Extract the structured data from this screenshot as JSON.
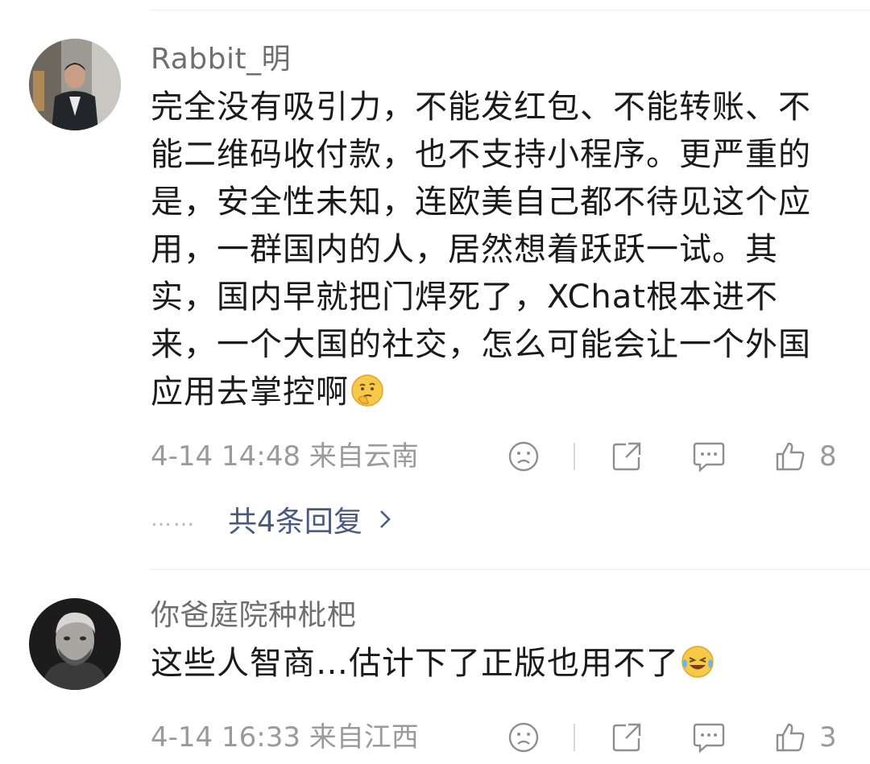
{
  "comments": [
    {
      "username": "Rabbit_明",
      "text": "完全没有吸引力，不能发红包、不能转账、不能二维码收付款，也不支持小程序。更严重的是，安全性未知，连欧美自己都不待见这个应用，一群国内的人，居然想着跃跃一试。其实，国内早就把门焊死了，XChat根本进不来，一个大国的社交，怎么可能会让一个外国应用去掌控啊",
      "emoji": "thinking-emoji",
      "meta": "4-14 14:48 来自云南",
      "likes": "8",
      "replies_label": "共4条回复",
      "replies_prefix": "……"
    },
    {
      "username": "你爸庭院种枇杷",
      "text": "这些人智商…估计下了正版也用不了",
      "emoji": "crying-laughing-emoji",
      "meta": "4-14 16:33 来自江西",
      "likes": "3"
    }
  ],
  "colors": {
    "username": "#6f6f6f",
    "body_text": "#1a1a1a",
    "meta": "#9a9a9a",
    "reply_link": "#4a5a7d",
    "divider": "#ececec"
  }
}
